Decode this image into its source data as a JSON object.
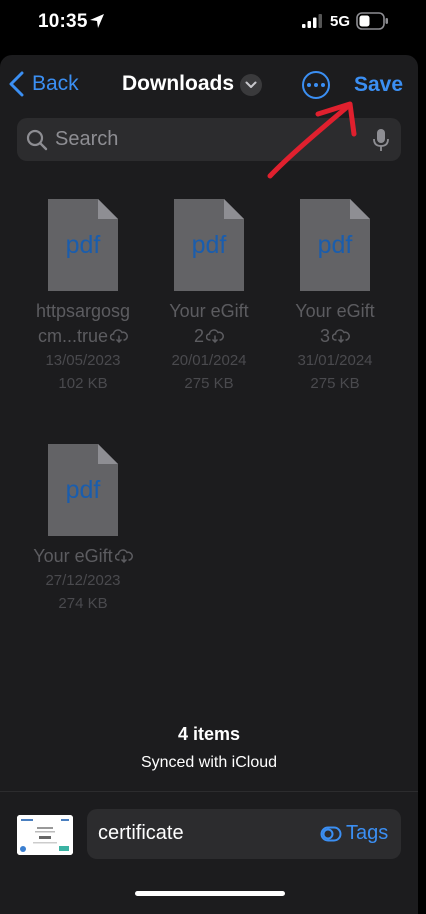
{
  "status": {
    "time": "10:35",
    "network": "5G"
  },
  "nav": {
    "back_label": "Back",
    "title": "Downloads",
    "save_label": "Save"
  },
  "search": {
    "placeholder": "Search"
  },
  "files": [
    {
      "icon_text": "pdf",
      "name_line1": "httpsargosg",
      "name_line2": "cm...true",
      "date": "13/05/2023",
      "size": "102 KB"
    },
    {
      "icon_text": "pdf",
      "name_line1": "Your eGift",
      "name_line2": "2",
      "date": "20/01/2024",
      "size": "275 KB"
    },
    {
      "icon_text": "pdf",
      "name_line1": "Your eGift",
      "name_line2": "3",
      "date": "31/01/2024",
      "size": "275 KB"
    },
    {
      "icon_text": "pdf",
      "name_line1": "Your eGift",
      "name_line2": "",
      "date": "27/12/2023",
      "size": "274 KB"
    }
  ],
  "footer": {
    "count": "4 items",
    "sync": "Synced with iCloud"
  },
  "save_bar": {
    "filename": "certificate",
    "tags_label": "Tags"
  },
  "colors": {
    "accent": "#3b8ff3",
    "sheet_bg": "#1c1c1e",
    "field_bg": "#2c2c2e",
    "annotation_red": "#e0202e"
  }
}
